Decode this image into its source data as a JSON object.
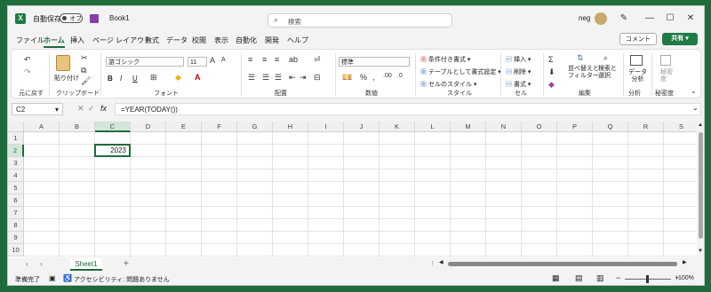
{
  "titlebar": {
    "autosave_label": "自動保存",
    "autosave_state": "オフ",
    "filename": "Book1",
    "search_placeholder": "検索",
    "user": "neg"
  },
  "menu": [
    "ファイル",
    "ホーム",
    "挿入",
    "ページ レイアウト",
    "数式",
    "データ",
    "校閲",
    "表示",
    "自動化",
    "開発",
    "ヘルプ"
  ],
  "menu_active": "ホーム",
  "comment_label": "コメント",
  "share_label": "共有",
  "ribbon": {
    "undo_group": "元に戻す",
    "paste_label": "貼り付け",
    "clipboard_group": "クリップボード",
    "font_name": "游ゴシック",
    "font_size": "11",
    "bold": "B",
    "italic": "I",
    "underline": "U",
    "font_group": "フォント",
    "align_group": "配置",
    "number_format": "標準",
    "number_group": "数値",
    "cond_format": "条件付き書式",
    "table_format": "テーブルとして書式設定",
    "cell_style": "セルのスタイル",
    "style_group": "スタイル",
    "insert": "挿入",
    "delete": "削除",
    "format": "書式",
    "cell_group": "セル",
    "sort_filter": "並べ替えと\nフィルター",
    "find_select": "検索と\n選択",
    "edit_group": "編集",
    "data_analysis": "データ\n分析",
    "analysis_group": "分析",
    "sensitivity": "秘密\n度",
    "sensitivity_group": "秘密度"
  },
  "formula_bar": {
    "name_box": "C2",
    "fx": "fx",
    "formula": "=YEAR(TODAY())"
  },
  "columns": [
    "A",
    "B",
    "C",
    "D",
    "E",
    "F",
    "G",
    "H",
    "I",
    "J",
    "K",
    "L",
    "M",
    "N",
    "O",
    "P",
    "Q",
    "R",
    "S"
  ],
  "rows": [
    "1",
    "2",
    "3",
    "4",
    "5",
    "6",
    "7",
    "8",
    "9",
    "10"
  ],
  "cell_c2_value": "2023",
  "sheet_tab": "Sheet1",
  "status": {
    "ready": "準備完了",
    "accessibility": "アクセシビリティ: 問題ありません",
    "zoom": "100%"
  }
}
